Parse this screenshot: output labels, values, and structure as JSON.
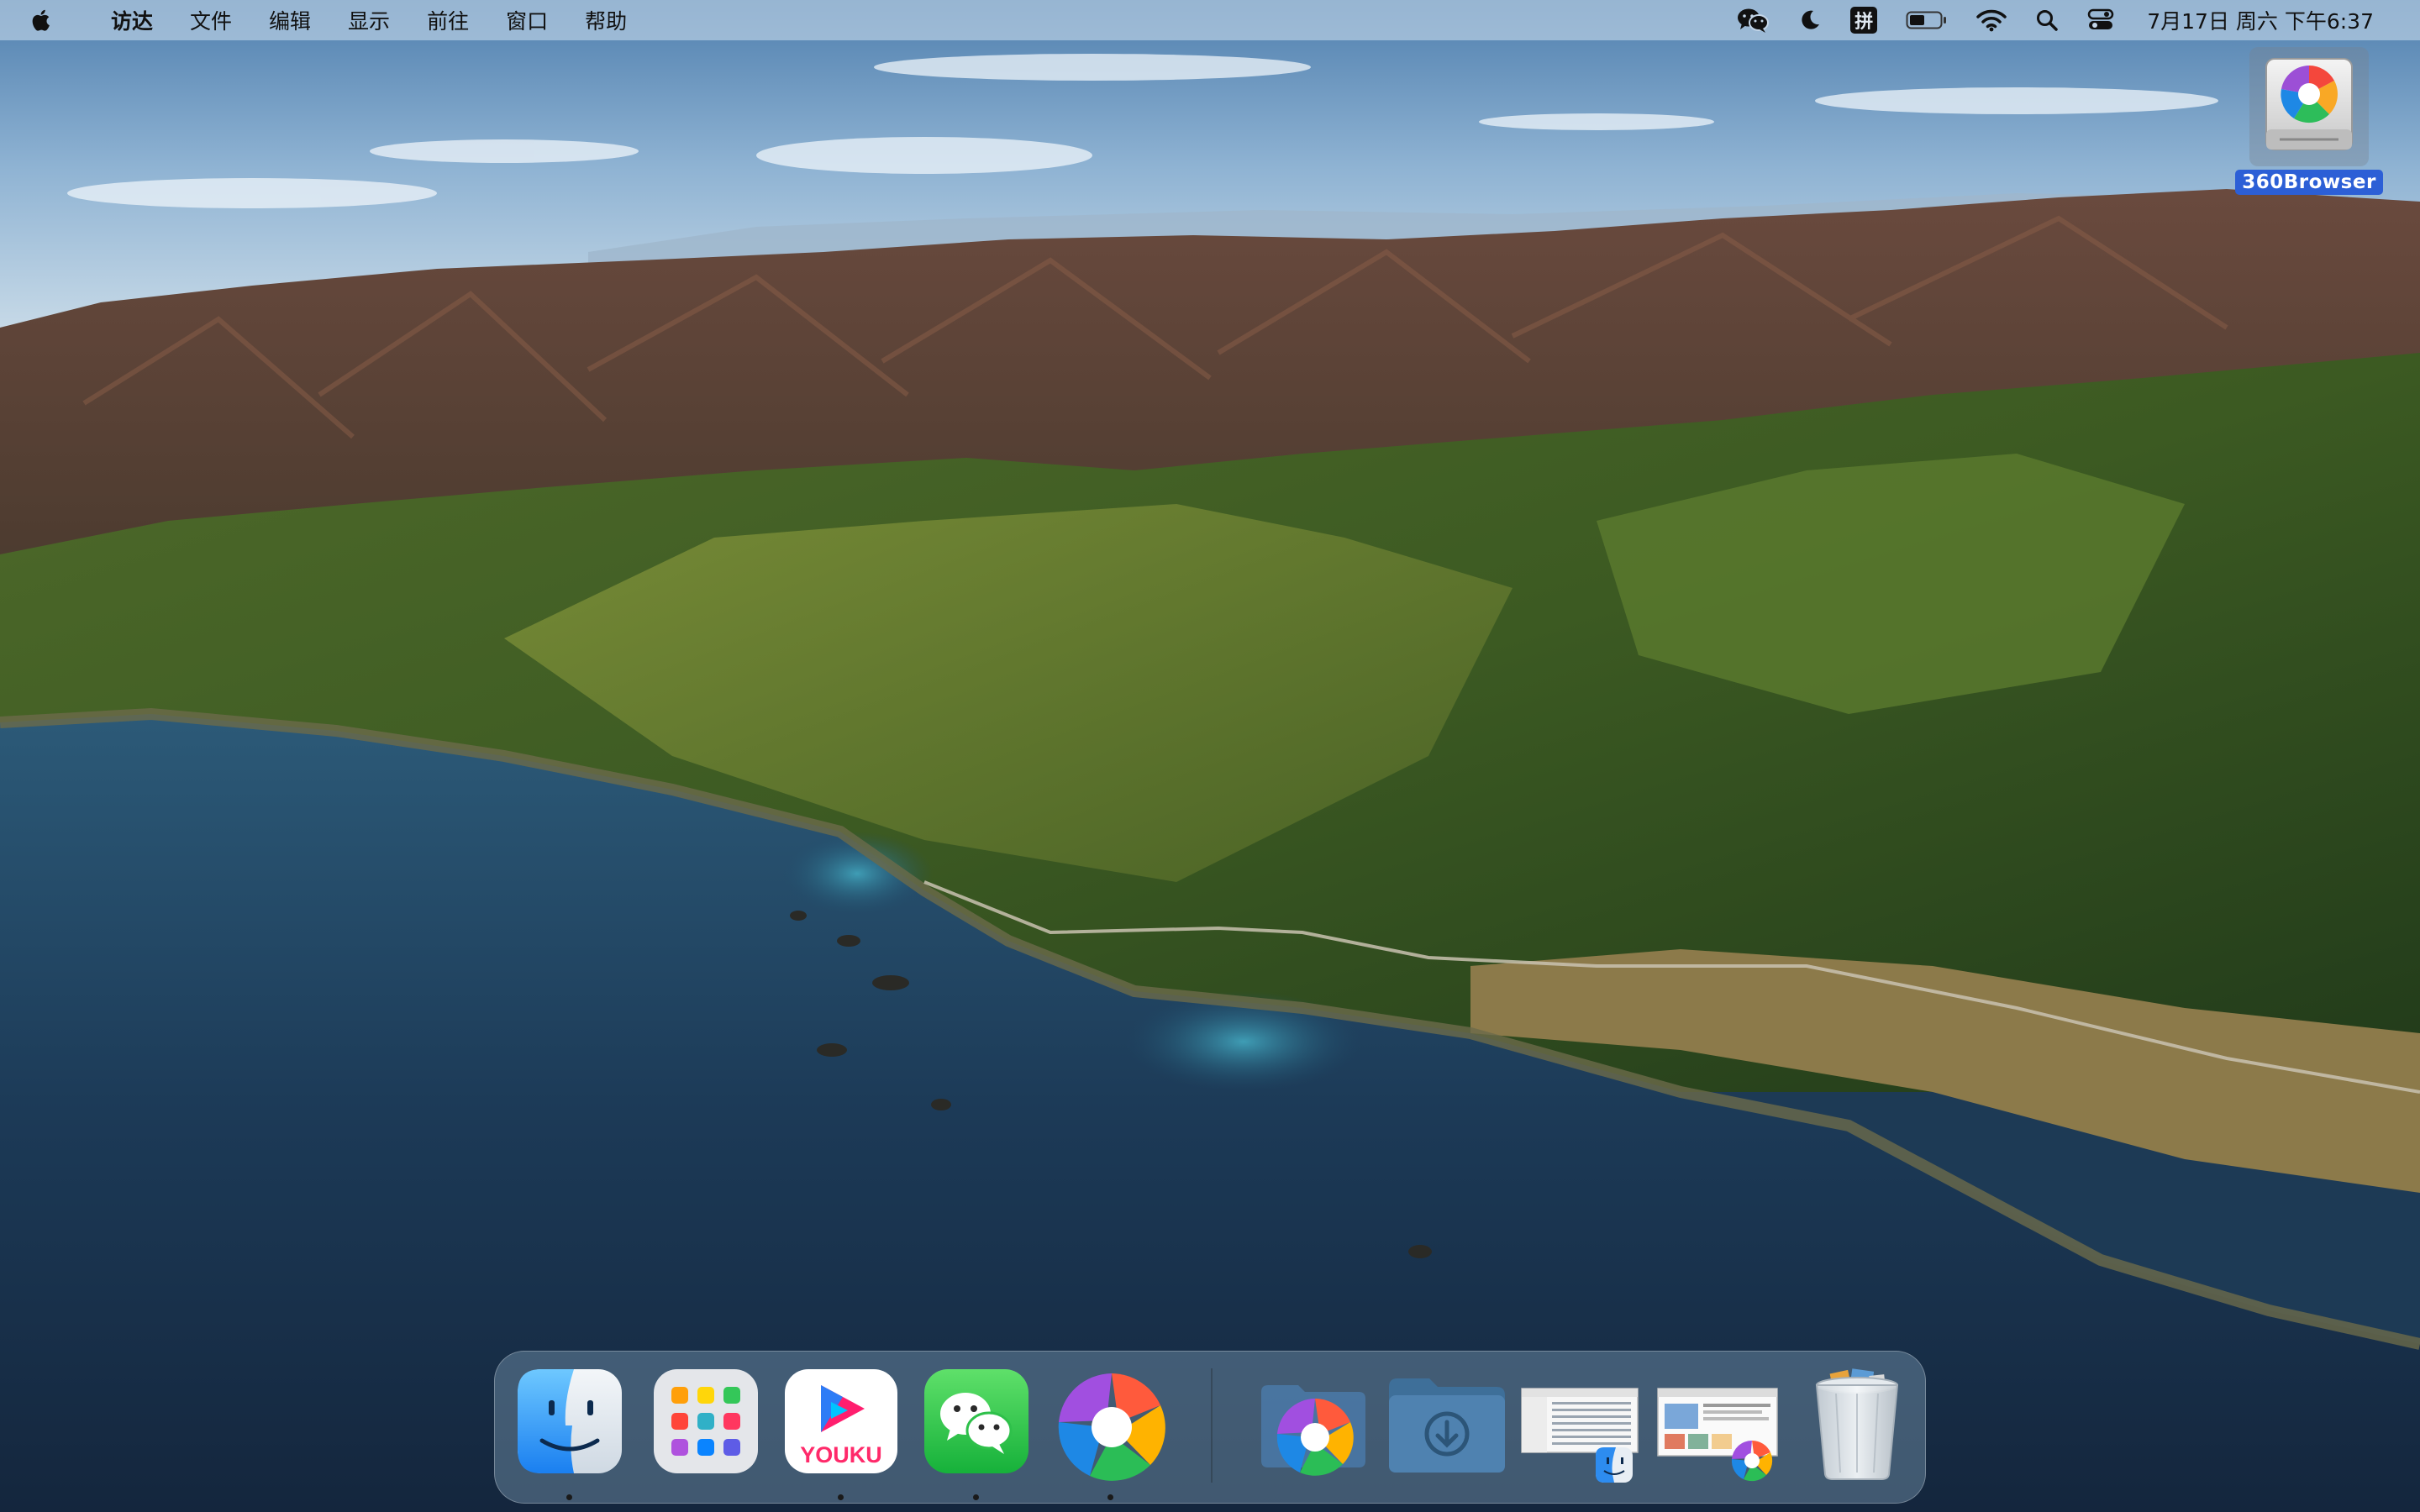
{
  "menubar": {
    "app_name": "访达",
    "menus": [
      "文件",
      "编辑",
      "显示",
      "前往",
      "窗口",
      "帮助"
    ],
    "status_icons": [
      "wechat-icon",
      "moon-icon",
      "input-method-icon",
      "battery-icon",
      "wifi-icon",
      "search-icon",
      "control-center-icon"
    ],
    "input_method_label": "拼",
    "clock": "7月17日 周六 下午6:37"
  },
  "desktop": {
    "drive": {
      "name": "360Browser",
      "icon": "disk-image-icon"
    }
  },
  "dock": {
    "apps": [
      {
        "name": "Finder",
        "icon": "finder-icon",
        "running": true
      },
      {
        "name": "Launchpad",
        "icon": "launchpad-icon",
        "running": false
      },
      {
        "name": "Youku",
        "icon": "youku-icon",
        "label": "YOUKU",
        "running": true
      },
      {
        "name": "WeChat",
        "icon": "wechat-icon",
        "running": true
      },
      {
        "name": "360Browser",
        "icon": "browser-360-icon",
        "running": true
      }
    ],
    "others": [
      {
        "name": "Applications",
        "icon": "applications-stack-icon"
      },
      {
        "name": "Downloads",
        "icon": "downloads-folder-icon"
      },
      {
        "name": "Finder Window",
        "icon": "finder-window-thumbnail"
      },
      {
        "name": "360Browser Window",
        "icon": "browser-window-thumbnail"
      },
      {
        "name": "Trash",
        "icon": "trash-icon"
      }
    ]
  },
  "colors": {
    "menubar_bg": "#c4d6e8",
    "selection_blue": "#2c5fd6",
    "ocean": "#1d3a55"
  }
}
